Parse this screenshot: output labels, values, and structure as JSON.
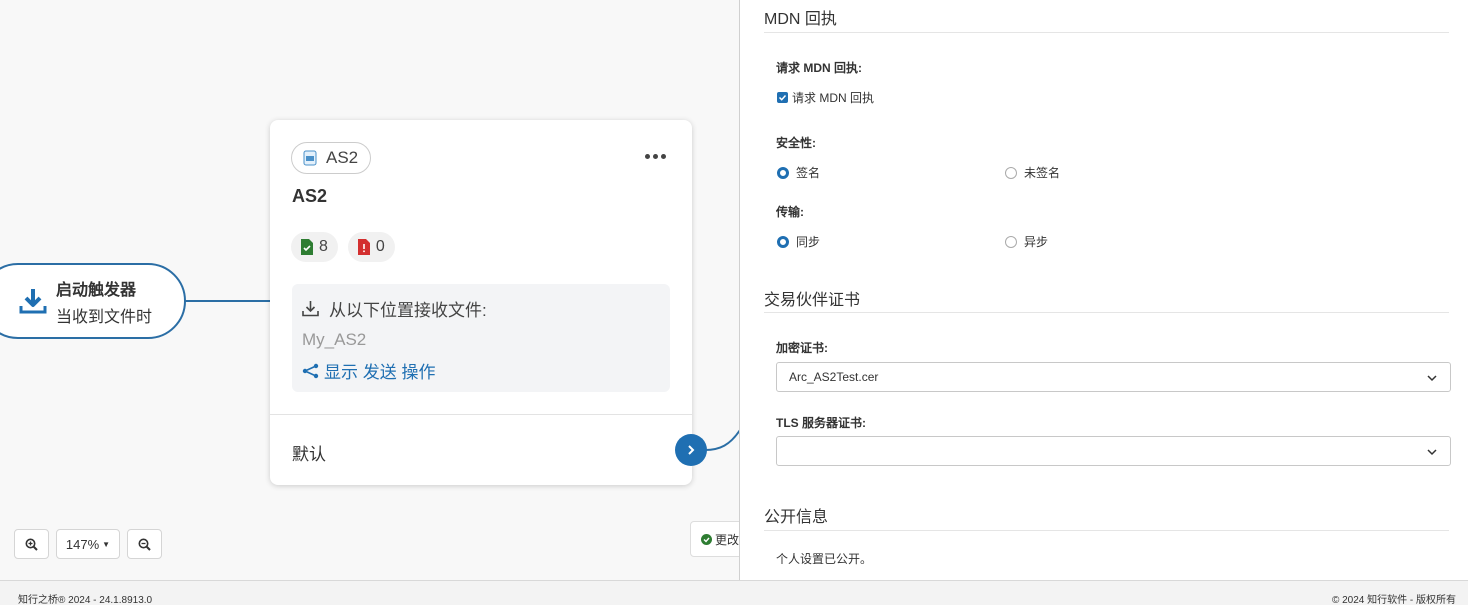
{
  "canvas": {
    "trigger": {
      "title": "启动触发器",
      "subtitle": "当收到文件时"
    },
    "card": {
      "badge_label": "AS2",
      "title": "AS2",
      "success_count": "8",
      "error_count": "0",
      "receive_label": "从以下位置接收文件:",
      "receive_path": "My_AS2",
      "show_send_action": "显示 发送 操作",
      "default_label": "默认"
    },
    "zoom": {
      "level": "147%"
    },
    "save_chip": "更改"
  },
  "panel": {
    "mdn": {
      "title": "MDN 回执",
      "request_label": "请求 MDN 回执:",
      "request_checkbox": "请求 MDN 回执",
      "request_checked": true,
      "security_label": "安全性:",
      "security_options": [
        "签名",
        "未签名"
      ],
      "security_selected": "签名",
      "transport_label": "传输:",
      "transport_options": [
        "同步",
        "异步"
      ],
      "transport_selected": "同步"
    },
    "certs": {
      "title": "交易伙伴证书",
      "encryption_label": "加密证书:",
      "encryption_value": "Arc_AS2Test.cer",
      "tls_label": "TLS 服务器证书:",
      "tls_value": ""
    },
    "public": {
      "title": "公开信息",
      "text": "个人设置已公开。"
    }
  },
  "footer": {
    "left": "知行之桥® 2024 - 24.1.8913.0",
    "right": "© 2024 知行软件 - 版权所有"
  },
  "colors": {
    "accent": "#1f6fb2",
    "success": "#2e7d32",
    "error": "#d32f2f"
  }
}
